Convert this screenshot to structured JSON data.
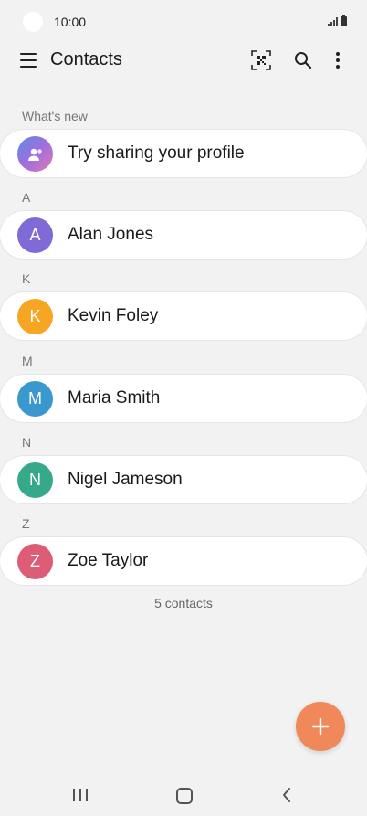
{
  "status_bar": {
    "time": "10:00"
  },
  "app_bar": {
    "title": "Contacts",
    "menu_icon": "hamburger-menu-icon",
    "qr_icon": "qr-code-scan-icon",
    "search_icon": "search-icon",
    "more_icon": "more-vertical-icon"
  },
  "sections": [
    {
      "header": "What's new",
      "items": [
        {
          "name": "Try sharing your profile",
          "avatar_text": "",
          "avatar_icon": "profile-share-icon",
          "avatar_color": "#7b6fe0"
        }
      ]
    },
    {
      "header": "A",
      "items": [
        {
          "name": "Alan Jones",
          "avatar_text": "A",
          "avatar_color": "#7f6ad6"
        }
      ]
    },
    {
      "header": "K",
      "items": [
        {
          "name": "Kevin Foley",
          "avatar_text": "K",
          "avatar_color": "#f7a624"
        }
      ]
    },
    {
      "header": "M",
      "items": [
        {
          "name": "Maria Smith",
          "avatar_text": "M",
          "avatar_color": "#3a98cf"
        }
      ]
    },
    {
      "header": "N",
      "items": [
        {
          "name": "Nigel Jameson",
          "avatar_text": "N",
          "avatar_color": "#37a98b"
        }
      ]
    },
    {
      "header": "Z",
      "items": [
        {
          "name": "Zoe Taylor",
          "avatar_text": "Z",
          "avatar_color": "#dd5c76"
        }
      ]
    }
  ],
  "contact_count": "5 contacts",
  "fab": {
    "icon": "add-icon",
    "color": "#f0885a"
  },
  "nav_bar": {
    "recents_icon": "recent-apps-icon",
    "home_icon": "home-icon",
    "back_icon": "back-icon"
  }
}
